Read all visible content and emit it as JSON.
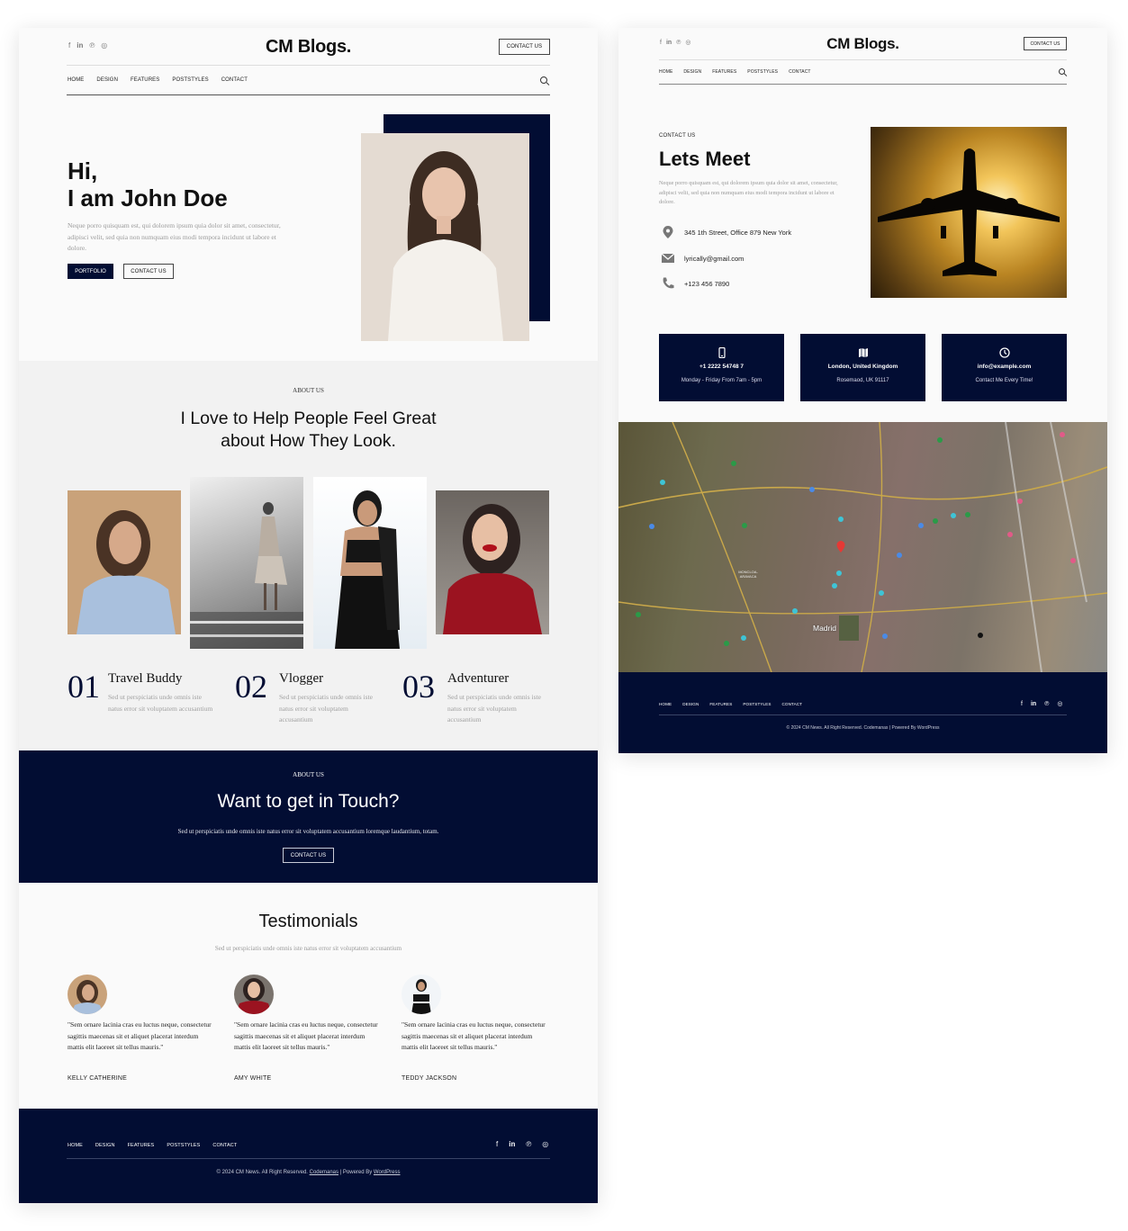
{
  "left_page": {
    "header": {
      "social_icons": [
        "facebook-icon",
        "linkedin-icon",
        "pinterest-icon",
        "instagram-icon"
      ],
      "social_glyphs": [
        "f",
        "in",
        "℗",
        "◎"
      ],
      "logo": "CM Blogs.",
      "contact_button": "CONTACT US",
      "nav": [
        "HOME",
        "DESIGN",
        "FEATURES",
        "POSTSTYLES",
        "CONTACT"
      ]
    },
    "hero": {
      "greeting": "Hi,",
      "name_line": "I am John Doe",
      "description": "Neque porro quisquam est, qui dolorem ipsum quia dolor sit amet, consectetur, adipisci velit, sed quia non numquam eius modi tempora incidunt ut labore et dolore.",
      "primary_button": "PORTFOLIO",
      "secondary_button": "CONTACT US"
    },
    "about": {
      "eyebrow": "ABOUT US",
      "title_line1": "I Love to Help People Feel Great",
      "title_line2": "about How They Look.",
      "features": [
        {
          "number": "01",
          "title": "Travel Buddy",
          "text": "Sed ut perspiciatis unde omnis iste natus error sit voluptatem accusantium"
        },
        {
          "number": "02",
          "title": "Vlogger",
          "text": "Sed ut perspiciatis unde omnis iste natus error sit voluptatem accusantium"
        },
        {
          "number": "03",
          "title": "Adventurer",
          "text": "Sed ut perspiciatis unde omnis iste natus error sit voluptatem accusantium"
        }
      ]
    },
    "cta": {
      "eyebrow": "ABOUT US",
      "title": "Want to get in Touch?",
      "text": "Sed ut perspiciatis unde omnis iste natus error sit voluptatem accusantium loremque laudantium, totam.",
      "button": "CONTACT US"
    },
    "testimonials": {
      "title": "Testimonials",
      "subtitle": "Sed ut perspiciatis unde omnis iste natus error sit voluptatem accusantium",
      "items": [
        {
          "quote": "\"Sem ornare lacinia cras eu luctus neque, consectetur sagittis maecenas sit et aliquet placerat interdum mattis elit laoreet sit tellus mauris.\"",
          "name": "KELLY CATHERINE"
        },
        {
          "quote": "\"Sem ornare lacinia cras eu luctus neque, consectetur sagittis maecenas sit et aliquet placerat interdum mattis elit laoreet sit tellus mauris.\"",
          "name": "AMY WHITE"
        },
        {
          "quote": "\"Sem ornare lacinia cras eu luctus neque, consectetur sagittis maecenas sit et aliquet placerat interdum mattis elit laoreet sit tellus mauris.\"",
          "name": "TEDDY JACKSON"
        }
      ]
    },
    "footer": {
      "nav": [
        "HOME",
        "DESIGN",
        "FEATURES",
        "POSTSTYLES",
        "CONTACT"
      ],
      "copyright_prefix": "© 2024 CM News. All Right Reserved.",
      "company_link": "Codemanas",
      "powered_prefix": "| Powered By",
      "powered_link": "WordPress"
    }
  },
  "right_page": {
    "header": {
      "logo": "CM Blogs.",
      "contact_button": "CONTACT US",
      "nav": [
        "HOME",
        "DESIGN",
        "FEATURES",
        "POSTSTYLES",
        "CONTACT"
      ]
    },
    "contact": {
      "eyebrow": "CONTACT US",
      "title": "Lets Meet",
      "description": "Neque porro quisquam est, qui dolorem ipsum quia dolor sit amet, consectetur, adipisci velit, sed quia non numquam eius modi tempora incidunt ut labore et dolore.",
      "address": "345 1th Street, Office 879 New York",
      "email": "lyrically@gmail.com",
      "phone": "+123 456 7890"
    },
    "cards": [
      {
        "icon": "mobile-phone-icon",
        "title": "+1 2222 54748 7",
        "subtitle": "Monday - Friday From 7am - 5pm"
      },
      {
        "icon": "map-icon",
        "title": "London, United Kingdom",
        "subtitle": "Rosemaod, UK 91117"
      },
      {
        "icon": "clock-icon",
        "title": "info@example.com",
        "subtitle": "Contact Me Every Time!"
      }
    ],
    "map": {
      "city_label": "Madrid",
      "district_label": "MONCLOA-ARAVACA"
    },
    "footer": {
      "nav": [
        "HOME",
        "DESIGN",
        "FEATURES",
        "POSTSTYLES",
        "CONTACT"
      ],
      "copyright": "© 2024 CM News. All Right Reserved. Codemanas | Powered By WordPress"
    }
  },
  "colors": {
    "navy": "#020d33",
    "page_bg": "#fafafa",
    "section_gray": "#f2f2f2",
    "muted_text": "#9a9a9a"
  }
}
